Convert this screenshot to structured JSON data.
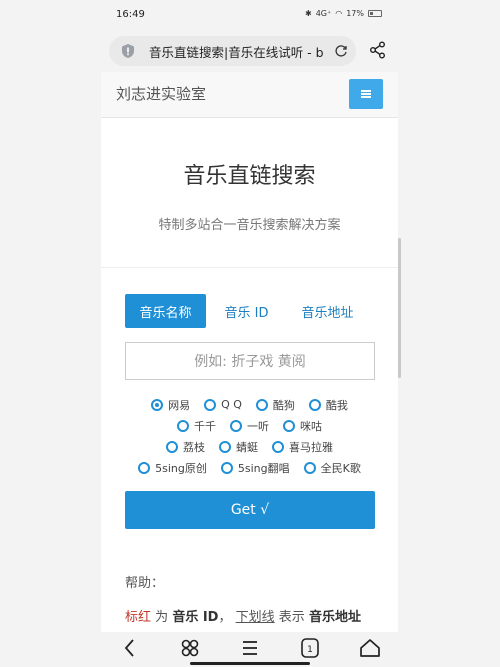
{
  "status_bar": {
    "time": "16:49",
    "network": "4G⁺",
    "battery": "17%"
  },
  "browser": {
    "url": "音乐直链搜索|音乐在线试听 - b"
  },
  "site": {
    "brand": "刘志进实验室"
  },
  "hero": {
    "title": "音乐直链搜索",
    "subtitle": "特制多站合一音乐搜索解决方案"
  },
  "tabs": [
    {
      "label": "音乐名称",
      "active": true
    },
    {
      "label": "音乐 ID",
      "active": false
    },
    {
      "label": "音乐地址",
      "active": false
    }
  ],
  "search": {
    "placeholder": "例如: 折子戏 黄阅"
  },
  "sources": {
    "row1": [
      "网易",
      "Q Q",
      "酷狗",
      "酷我"
    ],
    "row2": [
      "千千",
      "一听",
      "咪咕"
    ],
    "row3": [
      "荔枝",
      "蜻蜓",
      "喜马拉雅"
    ],
    "row4": [
      "5sing原创",
      "5sing翻唱",
      "全民K歌"
    ],
    "selected": "网易"
  },
  "get_button": {
    "label": "Get √"
  },
  "help": {
    "title": "帮助：",
    "hint_red": "标红",
    "hint_t1": "为",
    "hint_b1": "音乐 ID",
    "hint_t2": "，",
    "hint_u": "下划线",
    "hint_t3": "表示",
    "hint_b2": "音乐地址"
  },
  "colors": {
    "accent": "#1f8fd6",
    "menu_button": "#3fa9e9",
    "highlight_red": "#c0392b"
  }
}
